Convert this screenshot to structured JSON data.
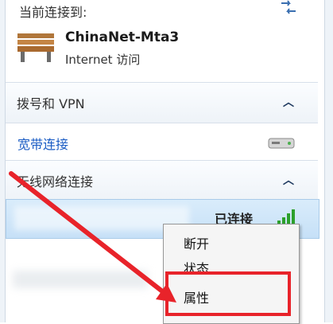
{
  "header": {
    "current_label": "当前连接到:"
  },
  "connected_network": {
    "name": "ChinaNet-Mta3",
    "access": "Internet 访问"
  },
  "dialup_section": {
    "label": "拨号和 VPN"
  },
  "broadband": {
    "label": "宽带连接"
  },
  "wireless_section": {
    "label": "无线网络连接"
  },
  "wireless_network": {
    "status": "已连接"
  },
  "context_menu": {
    "items": [
      {
        "label": "断开"
      },
      {
        "label": "状态"
      },
      {
        "label": "属性"
      }
    ]
  },
  "colors": {
    "highlight": "#e8232a",
    "link": "#1a5cc4",
    "selection": "#c6e0f7"
  },
  "icons": [
    "refresh-icon",
    "bench-network-icon",
    "chevron-up-icon",
    "modem-icon",
    "wifi-signal-icon"
  ]
}
